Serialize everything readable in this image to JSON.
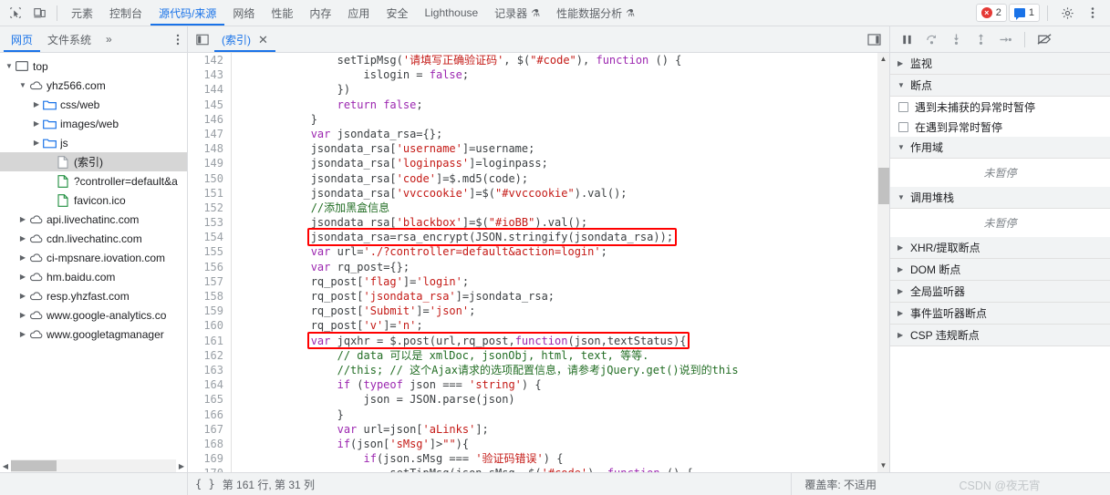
{
  "main_tabs": {
    "inspect_icon": "inspect-element-icon",
    "device_icon": "device-toolbar-icon",
    "items": [
      {
        "label": "元素",
        "active": false,
        "flask": false
      },
      {
        "label": "控制台",
        "active": false,
        "flask": false
      },
      {
        "label": "源代码/来源",
        "active": true,
        "flask": false
      },
      {
        "label": "网络",
        "active": false,
        "flask": false
      },
      {
        "label": "性能",
        "active": false,
        "flask": false
      },
      {
        "label": "内存",
        "active": false,
        "flask": false
      },
      {
        "label": "应用",
        "active": false,
        "flask": false
      },
      {
        "label": "安全",
        "active": false,
        "flask": false
      },
      {
        "label": "Lighthouse",
        "active": false,
        "flask": false
      },
      {
        "label": "记录器",
        "active": false,
        "flask": true
      },
      {
        "label": "性能数据分析",
        "active": false,
        "flask": true
      }
    ],
    "error_count": "2",
    "message_count": "1",
    "settings_icon": "gear-icon",
    "more_icon": "kebab-menu-icon"
  },
  "sub_tabs": {
    "nav_items": [
      {
        "label": "网页",
        "active": true
      },
      {
        "label": "文件系统",
        "active": false
      },
      {
        "label": "»",
        "active": false
      }
    ],
    "more_icon": "kebab-menu-icon",
    "panel_toggle_icon": "show-navigator-icon",
    "open_file": "(索引)",
    "close_icon": "close-icon",
    "split_icon": "show-debugger-sidebar-icon"
  },
  "file_tree": [
    {
      "label": "top",
      "depth": 0,
      "icon": "frame-icon",
      "twisty": "down",
      "selected": false
    },
    {
      "label": "yhz566.com",
      "depth": 1,
      "icon": "cloud-icon",
      "twisty": "down",
      "selected": false
    },
    {
      "label": "css/web",
      "depth": 2,
      "icon": "folder-icon",
      "twisty": "right",
      "selected": false
    },
    {
      "label": "images/web",
      "depth": 2,
      "icon": "folder-icon",
      "twisty": "right",
      "selected": false
    },
    {
      "label": "js",
      "depth": 2,
      "icon": "folder-icon",
      "twisty": "right",
      "selected": false
    },
    {
      "label": "(索引)",
      "depth": 3,
      "icon": "document-icon",
      "twisty": "none",
      "selected": true
    },
    {
      "label": "?controller=default&a",
      "depth": 3,
      "icon": "script-icon",
      "twisty": "none",
      "selected": false
    },
    {
      "label": "favicon.ico",
      "depth": 3,
      "icon": "script-icon",
      "twisty": "none",
      "selected": false
    },
    {
      "label": "api.livechatinc.com",
      "depth": 1,
      "icon": "cloud-icon",
      "twisty": "right",
      "selected": false
    },
    {
      "label": "cdn.livechatinc.com",
      "depth": 1,
      "icon": "cloud-icon",
      "twisty": "right",
      "selected": false
    },
    {
      "label": "ci-mpsnare.iovation.com",
      "depth": 1,
      "icon": "cloud-icon",
      "twisty": "right",
      "selected": false
    },
    {
      "label": "hm.baidu.com",
      "depth": 1,
      "icon": "cloud-icon",
      "twisty": "right",
      "selected": false
    },
    {
      "label": "resp.yhzfast.com",
      "depth": 1,
      "icon": "cloud-icon",
      "twisty": "right",
      "selected": false
    },
    {
      "label": "www.google-analytics.co",
      "depth": 1,
      "icon": "cloud-icon",
      "twisty": "right",
      "selected": false
    },
    {
      "label": "www.googletagmanager",
      "depth": 1,
      "icon": "cloud-icon",
      "twisty": "right",
      "selected": false
    }
  ],
  "code": {
    "first_line": 142,
    "highlight_lines": [
      154,
      161
    ],
    "lines": [
      "                setTipMsg('请填写正确验证码', $(\"#code\"), function () {",
      "                    islogin = false;",
      "                })",
      "                return false;",
      "            }",
      "            var jsondata_rsa={};",
      "            jsondata_rsa['username']=username;",
      "            jsondata_rsa['loginpass']=loginpass;",
      "            jsondata_rsa['code']=$.md5(code);",
      "            jsondata_rsa['vvccookie']=$(\"#vvccookie\").val();",
      "            //添加黑盒信息",
      "            jsondata_rsa['blackbox']=$(\"#ioBB\").val();",
      "            jsondata_rsa=rsa_encrypt(JSON.stringify(jsondata_rsa));",
      "            var url='./?controller=default&action=login';",
      "            var rq_post={};",
      "            rq_post['flag']='login';",
      "            rq_post['jsondata_rsa']=jsondata_rsa;",
      "            rq_post['Submit']='json';",
      "            rq_post['v']='n';",
      "            var jqxhr = $.post(url,rq_post,function(json,textStatus){",
      "                // data 可以是 xmlDoc, jsonObj, html, text, 等等.",
      "                //this; // 这个Ajax请求的选项配置信息，请参考jQuery.get()说到的this",
      "                if (typeof json === 'string') {",
      "                    json = JSON.parse(json)",
      "                }",
      "                var url=json['aLinks'];",
      "                if(json['sMsg']>\"\"){",
      "                    if(json.sMsg === '验证码错误') {",
      "                        setTipMsg(json.sMsg, $('#code'), function () {"
    ]
  },
  "debugger": {
    "toolbar_icons": [
      "pause-resume-icon",
      "step-over-icon",
      "step-into-icon",
      "step-out-icon",
      "step-icon",
      "deactivate-breakpoints-icon"
    ],
    "sections": [
      {
        "label": "监视",
        "caret": "right"
      },
      {
        "label": "断点",
        "caret": "down"
      },
      {
        "label": "作用域",
        "caret": "down"
      },
      {
        "label": "调用堆栈",
        "caret": "down"
      },
      {
        "label": "XHR/提取断点",
        "caret": "right"
      },
      {
        "label": "DOM 断点",
        "caret": "right"
      },
      {
        "label": "全局监听器",
        "caret": "right"
      },
      {
        "label": "事件监听器断点",
        "caret": "right"
      },
      {
        "label": "CSP 违规断点",
        "caret": "right"
      }
    ],
    "breakpoint_checkboxes": [
      {
        "label": "遇到未捕获的异常时暂停",
        "checked": false
      },
      {
        "label": "在遇到异常时暂停",
        "checked": false
      }
    ],
    "scope_empty": "未暂停",
    "callstack_empty": "未暂停"
  },
  "statusbar": {
    "format_icon": "pretty-print-icon",
    "position": "第 161 行, 第 31 列",
    "coverage": "覆盖率: 不适用",
    "watermark": "CSDN @夜无宵"
  },
  "colors": {
    "accent": "#1a73e8",
    "highlight_box": "#ff0000",
    "error": "#e53935",
    "toolbar_bg": "#f1f3f4",
    "selection_bg": "#d6d6d6"
  }
}
